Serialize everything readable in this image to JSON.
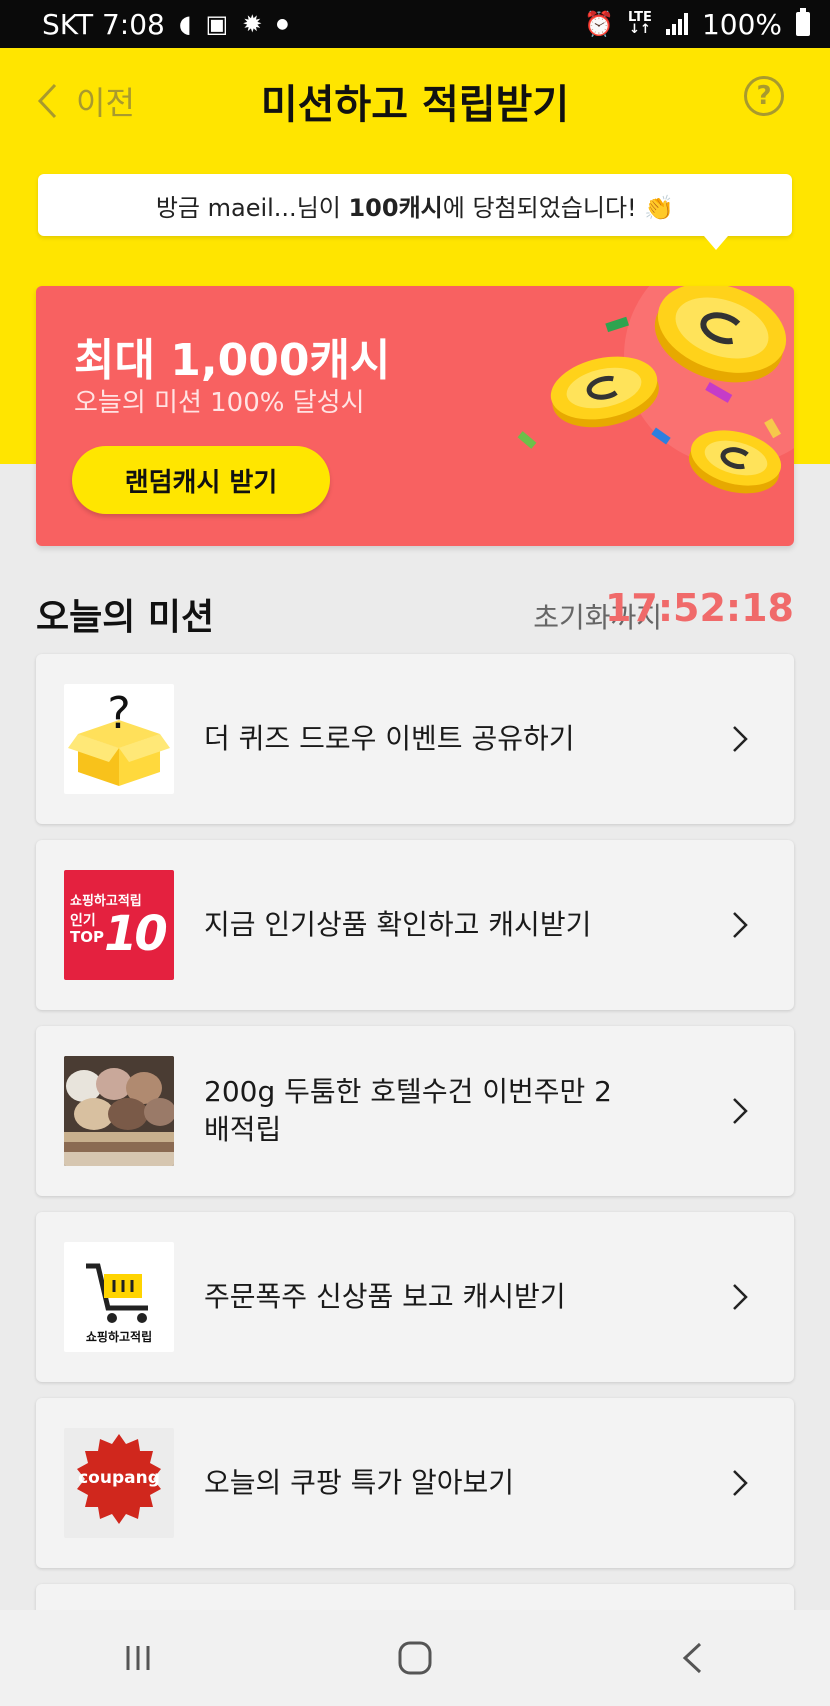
{
  "status_bar": {
    "carrier_time": "SKT 7:08",
    "network": "LTE",
    "battery": "100%"
  },
  "header": {
    "back_label": "이전",
    "title": "미션하고 적립받기",
    "help": "?"
  },
  "ticker": {
    "prefix": "방금 maeil...님이 ",
    "highlight": "100캐시",
    "suffix": "에 당첨되었습니다! 👏"
  },
  "banner": {
    "title": "최대 1,000캐시",
    "subtitle": "오늘의 미션 100% 달성시",
    "button_label": "랜덤캐시 받기"
  },
  "missions_section": {
    "title": "오늘의 미션",
    "timer_label": "초기화까지",
    "timer_value": "17:52:18"
  },
  "missions": [
    {
      "label": "더 퀴즈 드로우 이벤트 공유하기",
      "thumb": "mystery-box-icon"
    },
    {
      "label": "지금 인기상품 확인하고 캐시받기",
      "thumb": "top10-badge",
      "badge_line1": "쇼핑하고적립",
      "badge_line2": "인기",
      "badge_line3": "TOP",
      "badge_num": "10"
    },
    {
      "label": "200g 두툼한 호텔수건 이번주만 2배적립",
      "thumb": "towel-photo"
    },
    {
      "label": "주문폭주 신상품 보고 캐시받기",
      "thumb": "shopping-cart-icon",
      "cart_caption": "쇼핑하고적립"
    },
    {
      "label": "오늘의 쿠팡 특가 알아보기",
      "thumb": "coupang-logo",
      "logo_text": "coupang"
    }
  ],
  "colors": {
    "yellow": "#ffe500",
    "banner_red": "#f86161",
    "timer_red": "#f06a6a"
  }
}
